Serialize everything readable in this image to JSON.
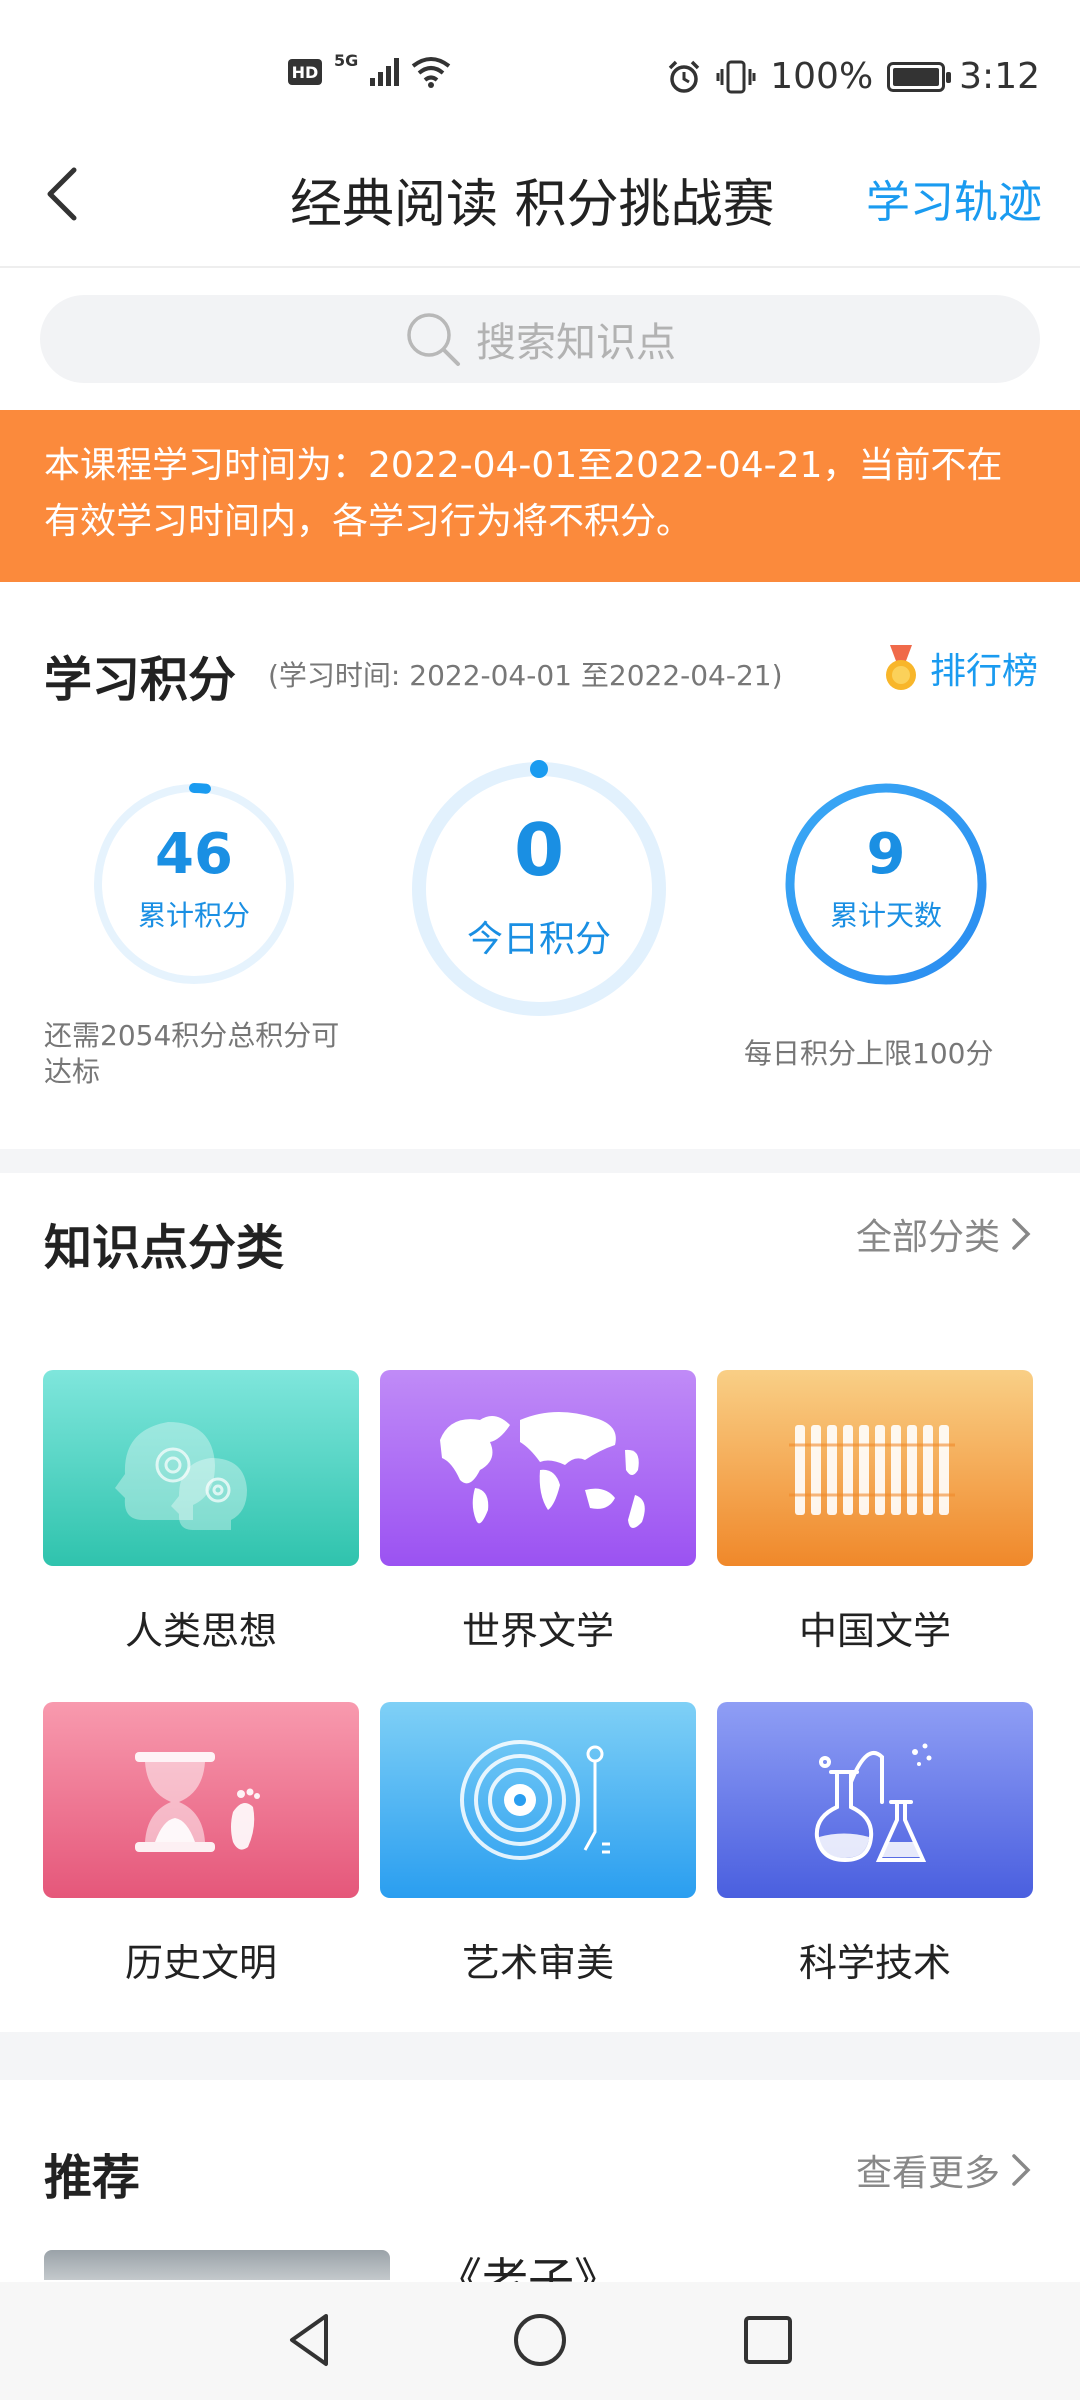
{
  "status_bar": {
    "hd": "HD",
    "network": "5G",
    "battery_percent": "100%",
    "time": "3:12"
  },
  "header": {
    "title": "经典阅读 积分挑战赛",
    "right_link": "学习轨迹"
  },
  "search": {
    "placeholder": "搜索知识点"
  },
  "banner": {
    "text": "本课程学习时间为：2022-04-01至2022-04-21，当前不在有效学习时间内，各学习行为将不积分。"
  },
  "score": {
    "title": "学习积分",
    "subtitle": "(学习时间: 2022-04-01 至2022-04-21)",
    "rank_label": "排行榜",
    "total": {
      "value": "46",
      "label": "累计积分",
      "progress": 0.02
    },
    "today": {
      "value": "0",
      "label": "今日积分",
      "progress": 0
    },
    "days": {
      "value": "9",
      "label": "累计天数",
      "progress": 1.0
    },
    "note_left": "还需2054积分总积分可达标",
    "note_right": "每日积分上限100分"
  },
  "categories": {
    "title": "知识点分类",
    "more_label": "全部分类",
    "items": [
      {
        "label": "人类思想",
        "icon": "heads-gears-icon",
        "color_top": "#7fe6dc",
        "color_bottom": "#2fc3ad"
      },
      {
        "label": "世界文学",
        "icon": "world-map-icon",
        "color_top": "#c08bf7",
        "color_bottom": "#9b52f2"
      },
      {
        "label": "中国文学",
        "icon": "bamboo-scroll-icon",
        "color_top": "#f9cf86",
        "color_bottom": "#f0882a"
      },
      {
        "label": "历史文明",
        "icon": "hourglass-footprint-icon",
        "color_top": "#f89aae",
        "color_bottom": "#e5577a"
      },
      {
        "label": "艺术审美",
        "icon": "record-player-icon",
        "color_top": "#7fd0f6",
        "color_bottom": "#2a9ef0"
      },
      {
        "label": "科学技术",
        "icon": "lab-flasks-icon",
        "color_top": "#8f9ef5",
        "color_bottom": "#4a5fdf"
      }
    ]
  },
  "recommend": {
    "title": "推荐",
    "more_label": "查看更多",
    "first_item_title": "《老子》"
  },
  "colors": {
    "accent": "#1a9bf0",
    "banner": "#fb8a3c"
  }
}
